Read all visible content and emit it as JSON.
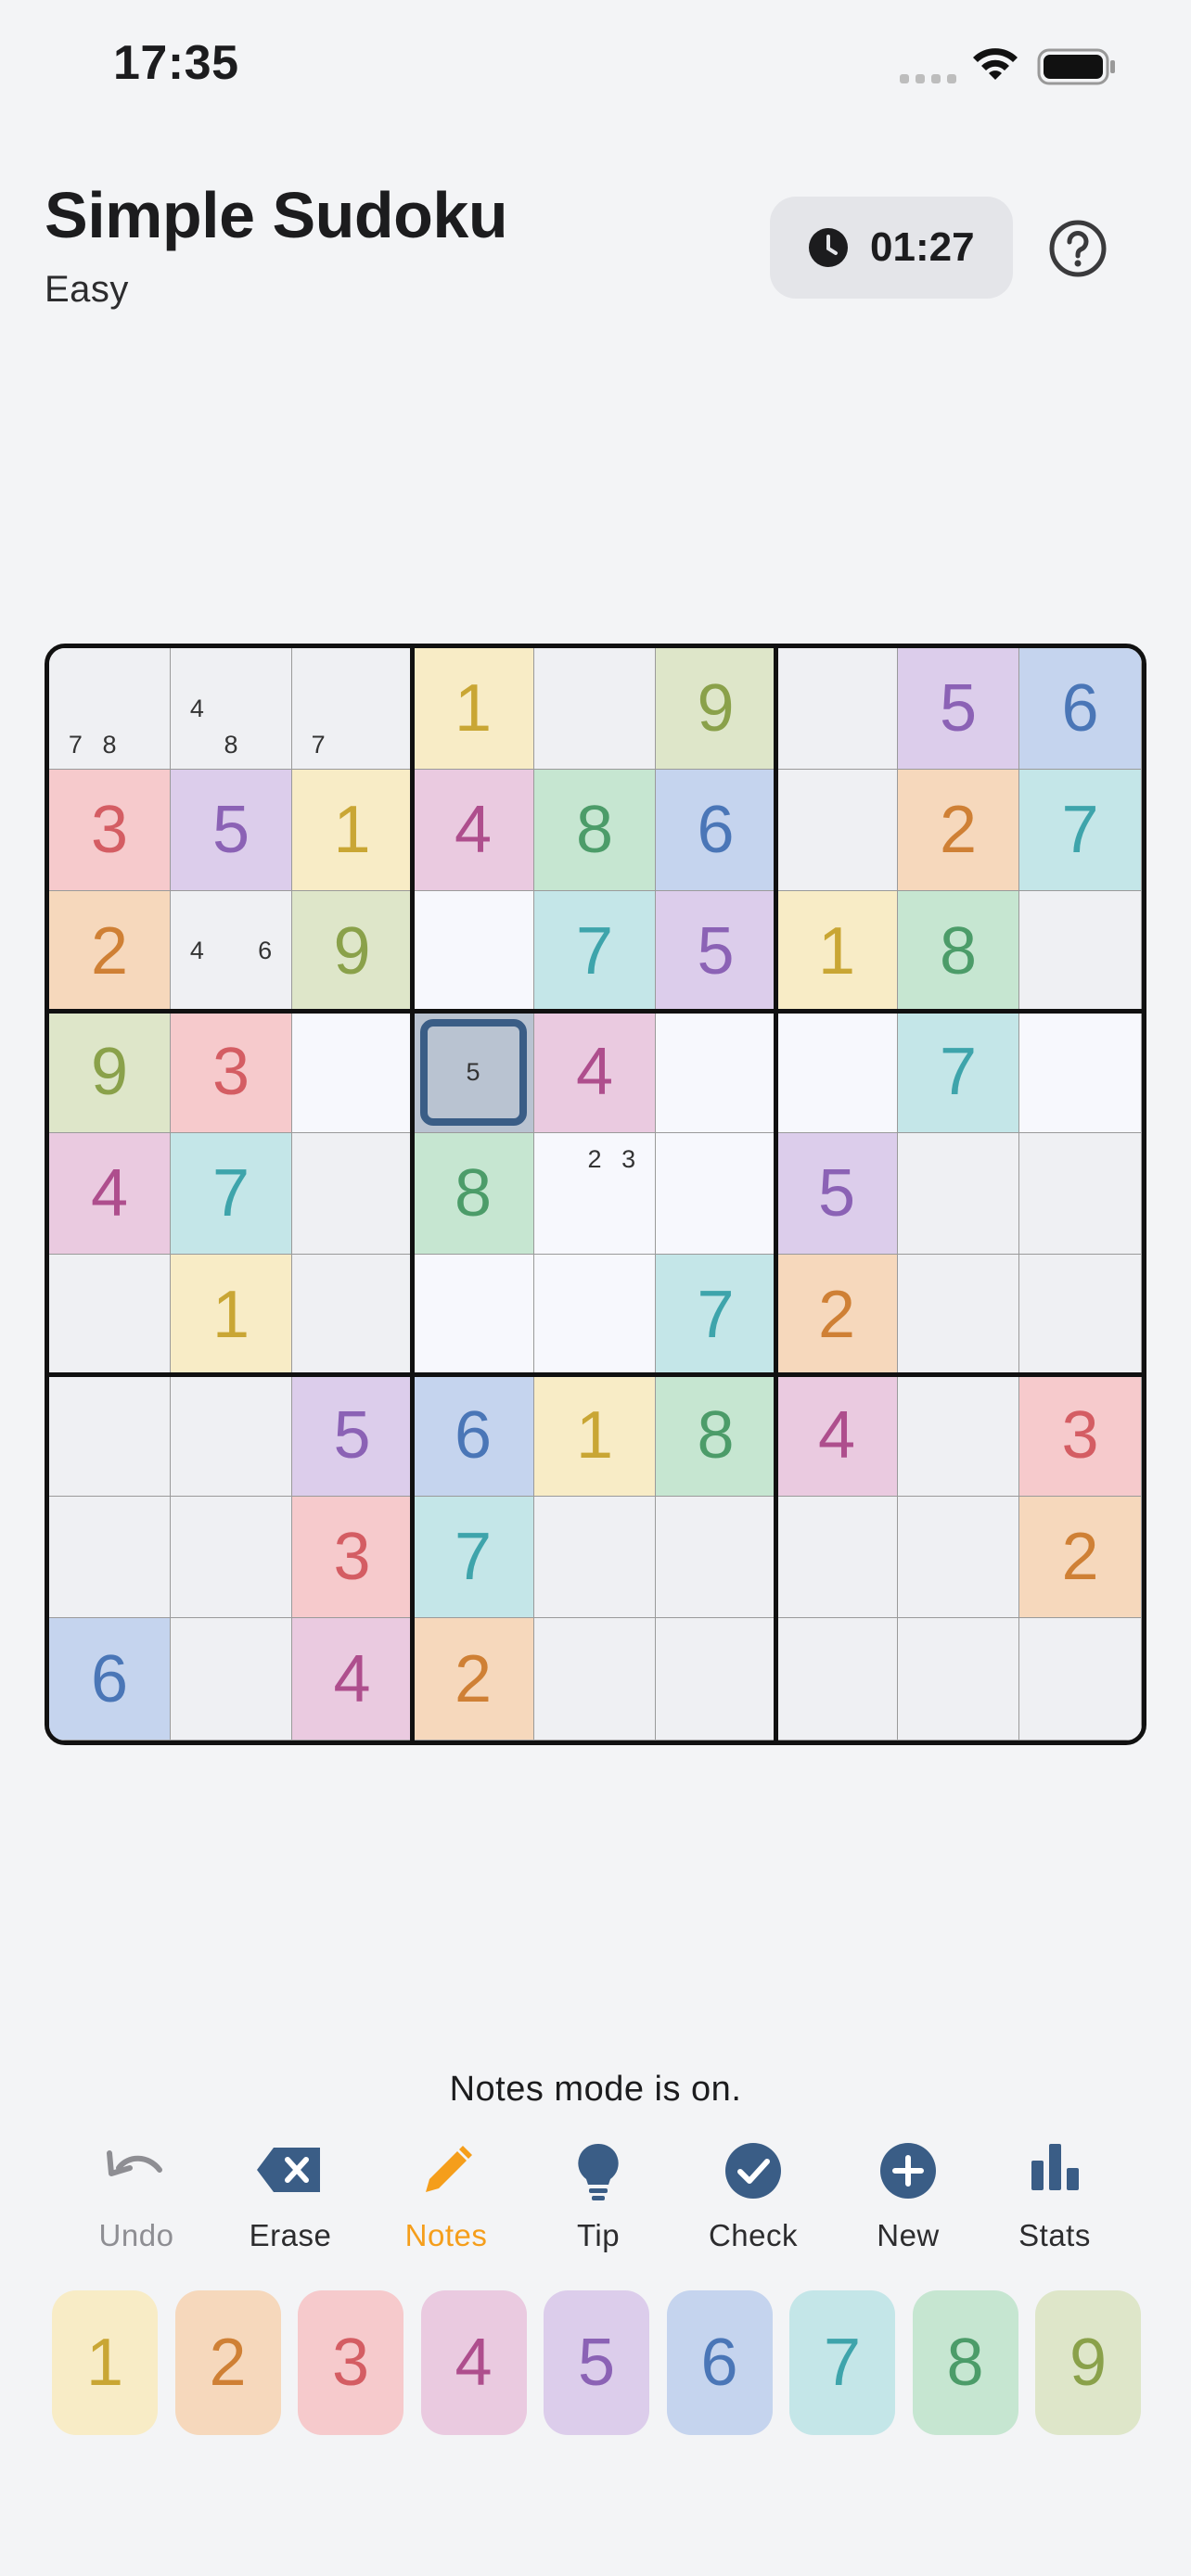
{
  "status_bar": {
    "time": "17:35"
  },
  "header": {
    "title": "Simple Sudoku",
    "difficulty": "Easy",
    "timer": "01:27"
  },
  "colors": {
    "1": {
      "bg": "#F8ECC6",
      "fg": "#C9A634"
    },
    "2": {
      "bg": "#F6D8BC",
      "fg": "#CF8035"
    },
    "3": {
      "bg": "#F6CACC",
      "fg": "#D45D63"
    },
    "4": {
      "bg": "#EACAE0",
      "fg": "#AE4E8D"
    },
    "5": {
      "bg": "#DCCDEB",
      "fg": "#8B62B5"
    },
    "6": {
      "bg": "#C5D4EE",
      "fg": "#4A76B7"
    },
    "7": {
      "bg": "#C4E6E8",
      "fg": "#3EA4AB"
    },
    "8": {
      "bg": "#C6E6D1",
      "fg": "#4C9C69"
    },
    "9": {
      "bg": "#DEE6C9",
      "fg": "#8AA14A"
    },
    "empty_highlight": "#EFF0F3",
    "empty_plain": "#F7F8FD",
    "selected": "#B9C3D1",
    "accent": "#3A5D86",
    "notes_accent": "#F59E1B"
  },
  "board": {
    "selected": [
      3,
      3
    ],
    "cells": [
      [
        "",
        "",
        "",
        "1",
        "",
        "9",
        "",
        "5",
        "6"
      ],
      [
        "3",
        "5",
        "1",
        "4",
        "8",
        "6",
        "",
        "2",
        "7"
      ],
      [
        "2",
        "",
        "9",
        "",
        "7",
        "5",
        "1",
        "8",
        ""
      ],
      [
        "9",
        "3",
        "",
        "",
        "4",
        "",
        "",
        "7",
        ""
      ],
      [
        "4",
        "7",
        "",
        "8",
        "",
        "",
        "5",
        "",
        ""
      ],
      [
        "",
        "1",
        "",
        "",
        "",
        "7",
        "2",
        "",
        ""
      ],
      [
        "",
        "",
        "5",
        "6",
        "1",
        "8",
        "4",
        "",
        "3"
      ],
      [
        "",
        "",
        "3",
        "7",
        "",
        "",
        "",
        "",
        "2"
      ],
      [
        "6",
        "",
        "4",
        "2",
        "",
        "",
        "",
        "",
        ""
      ]
    ],
    "notes": {
      "0-0": [
        "7",
        "8"
      ],
      "0-1": [
        "4",
        "8"
      ],
      "0-2": [
        "7"
      ],
      "2-1": [
        "4",
        "6"
      ],
      "3-3": [
        "5"
      ],
      "4-4": [
        "2",
        "3"
      ]
    },
    "plain_empty_cells": [
      "2-3",
      "3-2",
      "3-5",
      "3-6",
      "3-8",
      "4-4",
      "4-5",
      "5-3",
      "5-4"
    ]
  },
  "notes_message": "Notes mode is on.",
  "toolbar": {
    "undo": "Undo",
    "erase": "Erase",
    "notes": "Notes",
    "tip": "Tip",
    "check": "Check",
    "new": "New",
    "stats": "Stats"
  },
  "numpad": [
    "1",
    "2",
    "3",
    "4",
    "5",
    "6",
    "7",
    "8",
    "9"
  ]
}
